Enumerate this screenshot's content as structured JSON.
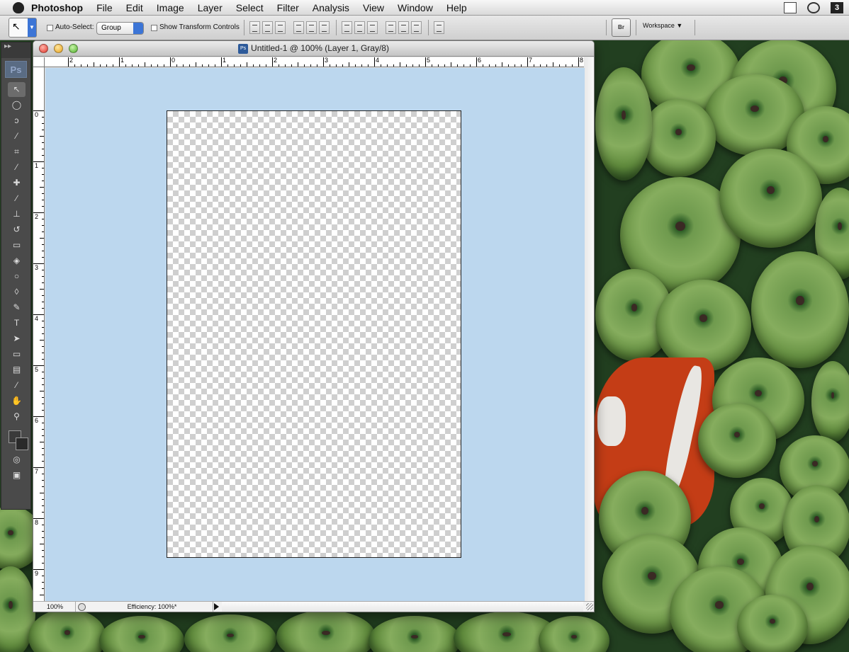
{
  "menubar": {
    "app_name": "Photoshop",
    "items": [
      "File",
      "Edit",
      "Image",
      "Layer",
      "Select",
      "Filter",
      "Analysis",
      "View",
      "Window",
      "Help"
    ],
    "status_badge": "3"
  },
  "options": {
    "auto_select_label": "Auto-Select:",
    "auto_select_value": "Group",
    "show_transform_label": "Show Transform Controls",
    "bridge_label": "Br",
    "workspace_label": "Workspace"
  },
  "toolbox": {
    "logo": "Ps",
    "collapse": "▸▸"
  },
  "document": {
    "title": "Untitled-1 @ 100% (Layer 1, Gray/8)",
    "ps_badge": "Ps",
    "hruler_labels": [
      "2",
      "1",
      "0",
      "1",
      "2",
      "3",
      "4",
      "5",
      "6",
      "7",
      "8"
    ],
    "vruler_labels": [
      "0",
      "1",
      "2",
      "3",
      "4",
      "5",
      "6",
      "7",
      "8",
      "9"
    ],
    "zoom": "100%",
    "efficiency": "Efficiency: 100%*"
  },
  "colors": {
    "pasteboard": "#bcd7ee",
    "toolbox": "#4a4a4a",
    "accent": "#3c75d6"
  }
}
